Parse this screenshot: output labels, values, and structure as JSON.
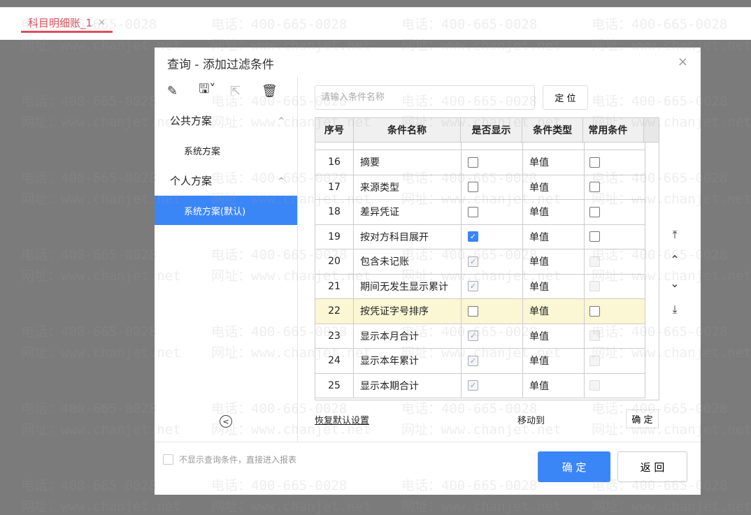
{
  "tab": {
    "label": "科目明细账_1",
    "close": "×"
  },
  "watermark": {
    "phone": "电话：400-665-0028",
    "site": "网址：www.chanjet.net"
  },
  "dialog": {
    "title": "查询 - 添加过滤条件",
    "close": "×"
  },
  "toolbar": {
    "icons": [
      "edit-icon",
      "save-icon",
      "export-icon",
      "delete-icon"
    ],
    "save": "🖫˅",
    "edit": "✎",
    "export": "⇱",
    "delete": "🗑"
  },
  "groups": [
    {
      "label": "公共方案",
      "items": [
        "系统方案"
      ]
    },
    {
      "label": "个人方案",
      "items": [
        "系统方案(默认)"
      ]
    }
  ],
  "search": {
    "placeholder": "请输入条件名称",
    "value": ""
  },
  "locate_label": "定 位",
  "columns": [
    "序号",
    "条件名称",
    "是否显示",
    "条件类型",
    "常用条件"
  ],
  "rows": [
    {
      "no": "16",
      "name": "摘要",
      "show": "off",
      "type": "单值",
      "common": "off"
    },
    {
      "no": "17",
      "name": "来源类型",
      "show": "off",
      "type": "单值",
      "common": "off"
    },
    {
      "no": "18",
      "name": "差异凭证",
      "show": "off",
      "type": "单值",
      "common": "off"
    },
    {
      "no": "19",
      "name": "按对方科目展开",
      "show": "on",
      "type": "单值",
      "common": "off"
    },
    {
      "no": "20",
      "name": "包含未记账",
      "show": "dison",
      "type": "单值",
      "common": "dis"
    },
    {
      "no": "21",
      "name": "期间无发生显示累计",
      "show": "dison",
      "type": "单值",
      "common": "dis"
    },
    {
      "no": "22",
      "name": "按凭证字号排序",
      "show": "off",
      "type": "单值",
      "common": "off",
      "highlight": true
    },
    {
      "no": "23",
      "name": "显示本月合计",
      "show": "dison",
      "type": "单值",
      "common": "dis"
    },
    {
      "no": "24",
      "name": "显示本年累计",
      "show": "dison",
      "type": "单值",
      "common": "dis"
    },
    {
      "no": "25",
      "name": "显示本期合计",
      "show": "dison",
      "type": "单值",
      "common": "dis"
    }
  ],
  "restore_label": "恢复默认设置",
  "move_to_label": "移动到",
  "move_ok_label": "确 定",
  "skip_label": "不显示查询条件，直接进入报表",
  "ok_label": "确 定",
  "back_label": "返 回"
}
